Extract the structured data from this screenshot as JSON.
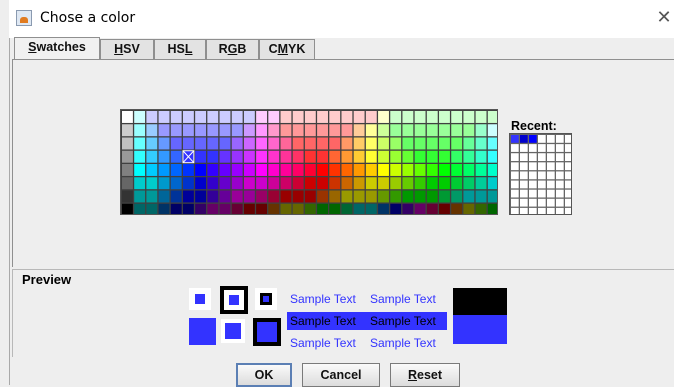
{
  "window": {
    "title": "Chose a color",
    "close_glyph": "✕",
    "app_icon": "java-cup-icon"
  },
  "tabs": [
    {
      "label_pre": "",
      "mnemonic": "S",
      "label_post": "watches",
      "active": true
    },
    {
      "label_pre": "",
      "mnemonic": "H",
      "label_post": "SV",
      "active": false
    },
    {
      "label_pre": "HS",
      "mnemonic": "L",
      "label_post": "",
      "active": false
    },
    {
      "label_pre": "R",
      "mnemonic": "G",
      "label_post": "B",
      "active": false
    },
    {
      "label_pre": "C",
      "mnemonic": "M",
      "label_post": "YK",
      "active": false
    }
  ],
  "swatches": {
    "selected": {
      "row": 3,
      "col": 5
    },
    "palette": [
      [
        "#ffffff",
        "#ccffff",
        "#ccccff",
        "#ccccff",
        "#ccccff",
        "#ccccff",
        "#ccccff",
        "#ccccff",
        "#ccccff",
        "#ccccff",
        "#ccccff",
        "#ffccff",
        "#ffccff",
        "#ffcccc",
        "#ffcccc",
        "#ffcccc",
        "#ffcccc",
        "#ffcccc",
        "#ffcccc",
        "#ffcccc",
        "#ffcccc",
        "#ffffcc",
        "#ccffcc",
        "#ccffcc",
        "#ccffcc",
        "#ccffcc",
        "#ccffcc",
        "#ccffcc",
        "#ccffcc",
        "#ccffcc",
        "#ccffcc"
      ],
      [
        "#cccccc",
        "#99ffff",
        "#99ccff",
        "#9999ff",
        "#9999ff",
        "#9999ff",
        "#9999ff",
        "#9999ff",
        "#9999ff",
        "#9999ff",
        "#cc99ff",
        "#ff99ff",
        "#ff99cc",
        "#ff9999",
        "#ff9999",
        "#ff9999",
        "#ff9999",
        "#ff9999",
        "#ff9999",
        "#ffcc99",
        "#ffff99",
        "#ccff99",
        "#99ff99",
        "#99ff99",
        "#99ff99",
        "#99ff99",
        "#99ff99",
        "#99ff99",
        "#99ff99",
        "#99ffcc",
        "#ccffff"
      ],
      [
        "#c0c0c0",
        "#66ffff",
        "#66ccff",
        "#6699ff",
        "#6666ff",
        "#6666ff",
        "#6666ff",
        "#6666ff",
        "#6666ff",
        "#9966ff",
        "#cc66ff",
        "#ff66ff",
        "#ff66cc",
        "#ff6699",
        "#ff6666",
        "#ff6666",
        "#ff6666",
        "#ff6666",
        "#ff9966",
        "#ffcc66",
        "#ffff66",
        "#ccff66",
        "#99ff66",
        "#66ff66",
        "#66ff66",
        "#66ff66",
        "#66ff66",
        "#66ff66",
        "#66ff99",
        "#66ffcc",
        "#66ffff"
      ],
      [
        "#999999",
        "#33ffff",
        "#33ccff",
        "#3399ff",
        "#3366ff",
        "#3333ff",
        "#3333ff",
        "#3333ff",
        "#6633ff",
        "#9933ff",
        "#cc33ff",
        "#ff33ff",
        "#ff33cc",
        "#ff3399",
        "#ff3366",
        "#ff3333",
        "#ff3333",
        "#ff6633",
        "#ff9933",
        "#ffcc33",
        "#ffff33",
        "#ccff33",
        "#99ff33",
        "#66ff33",
        "#33ff33",
        "#33ff33",
        "#33ff33",
        "#33ff66",
        "#33ff99",
        "#33ffcc",
        "#33ffff"
      ],
      [
        "#808080",
        "#00ffff",
        "#00ccff",
        "#0099ff",
        "#0066ff",
        "#0033ff",
        "#0000ff",
        "#3300ff",
        "#6600ff",
        "#9900ff",
        "#cc00ff",
        "#ff00ff",
        "#ff00cc",
        "#ff0099",
        "#ff0066",
        "#ff0033",
        "#ff0000",
        "#ff3300",
        "#ff6600",
        "#ff9900",
        "#ffcc00",
        "#ffff00",
        "#ccff00",
        "#99ff00",
        "#66ff00",
        "#33ff00",
        "#00ff00",
        "#00ff33",
        "#00ff66",
        "#00ff99",
        "#00ffcc"
      ],
      [
        "#666666",
        "#00cccc",
        "#00cccc",
        "#0099cc",
        "#0066cc",
        "#0033cc",
        "#0000cc",
        "#3300cc",
        "#6600cc",
        "#9900cc",
        "#cc00cc",
        "#cc00cc",
        "#cc0099",
        "#cc0066",
        "#cc0033",
        "#cc0000",
        "#cc0000",
        "#cc3300",
        "#cc6600",
        "#cc9900",
        "#cccc00",
        "#cccc00",
        "#99cc00",
        "#66cc00",
        "#33cc00",
        "#00cc00",
        "#00cc00",
        "#00cc33",
        "#00cc66",
        "#00cc99",
        "#00cccc"
      ],
      [
        "#333333",
        "#009999",
        "#009999",
        "#006699",
        "#003399",
        "#000099",
        "#000099",
        "#330099",
        "#660099",
        "#990099",
        "#990099",
        "#990066",
        "#990033",
        "#990000",
        "#990000",
        "#990000",
        "#993300",
        "#996600",
        "#999900",
        "#999900",
        "#999900",
        "#669900",
        "#339900",
        "#009900",
        "#009900",
        "#009900",
        "#009933",
        "#009966",
        "#009999",
        "#009999",
        "#009999"
      ],
      [
        "#000000",
        "#006666",
        "#006666",
        "#003366",
        "#000066",
        "#000066",
        "#330066",
        "#660066",
        "#660066",
        "#660033",
        "#660000",
        "#660000",
        "#663300",
        "#666600",
        "#666600",
        "#336600",
        "#006600",
        "#006600",
        "#006633",
        "#006666",
        "#006666",
        "#003366",
        "#000066",
        "#330066",
        "#660066",
        "#660033",
        "#660000",
        "#663300",
        "#666600",
        "#336600",
        "#006600"
      ]
    ]
  },
  "recent": {
    "label": "Recent:",
    "colors": [
      "#3333ff",
      "#0000cc",
      "#0000ff"
    ],
    "cols": 7,
    "rows": 9
  },
  "preview": {
    "label": "Preview",
    "sample_text": "Sample Text",
    "color": "#3333ff",
    "highlight_bg": "#3333ff"
  },
  "buttons": {
    "ok": "OK",
    "cancel": "Cancel",
    "reset_mnemonic": "R",
    "reset_rest": "eset"
  }
}
